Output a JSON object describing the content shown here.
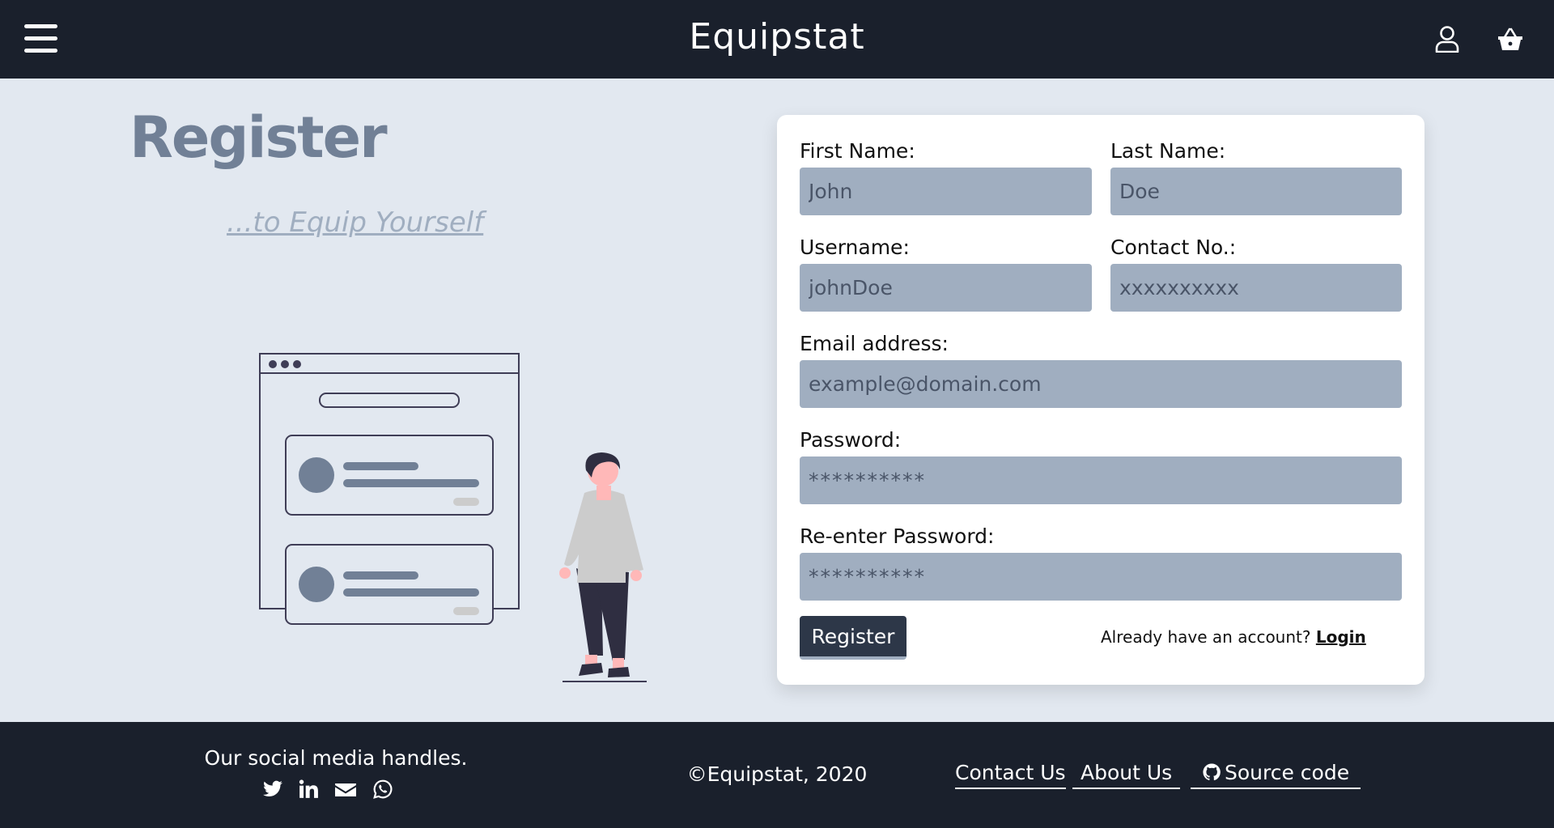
{
  "header": {
    "brand": "Equipstat",
    "menu_icon": "hamburger-menu-icon",
    "user_icon": "user-icon",
    "cart_icon": "shopping-basket-icon"
  },
  "hero": {
    "title": "Register",
    "tagline": "...to Equip Yourself"
  },
  "form": {
    "first_name": {
      "label": "First Name:",
      "placeholder": "John"
    },
    "last_name": {
      "label": "Last Name:",
      "placeholder": "Doe"
    },
    "username": {
      "label": "Username:",
      "placeholder": "johnDoe"
    },
    "contact": {
      "label": "Contact No.:",
      "placeholder": "xxxxxxxxxx"
    },
    "email": {
      "label": "Email address:",
      "placeholder": "example@domain.com"
    },
    "password": {
      "label": "Password:",
      "placeholder": "**********"
    },
    "repassword": {
      "label": "Re-enter Password:",
      "placeholder": "**********"
    },
    "submit_label": "Register",
    "login_prompt": "Already have an account?",
    "login_link": "Login"
  },
  "footer": {
    "social_title": "Our social media handles.",
    "social_icons": [
      "twitter-icon",
      "linkedin-icon",
      "envelope-icon",
      "whatsapp-icon"
    ],
    "copyright": "©Equipstat, 2020",
    "links": {
      "contact": "Contact Us",
      "about": "About Us",
      "source": "Source code"
    }
  },
  "colors": {
    "header_bg": "#1a202c",
    "page_bg": "#e2e8f0",
    "input_bg": "#a0aec0",
    "button_bg": "#2d3748",
    "title": "#718096"
  }
}
